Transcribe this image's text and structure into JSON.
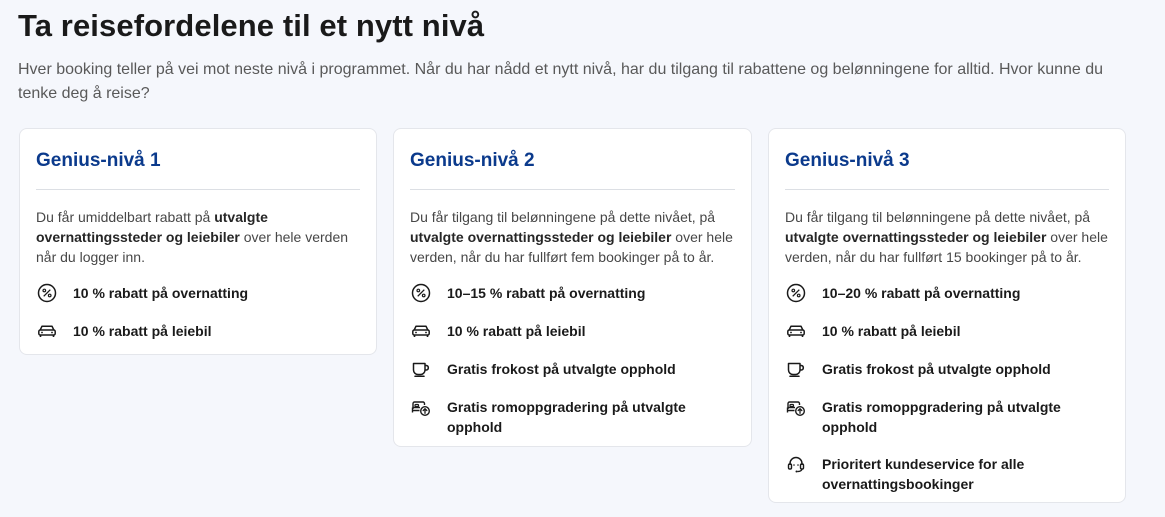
{
  "header": {
    "title": "Ta reisefordelene til et nytt nivå",
    "subtitle": "Hver booking teller på vei mot neste nivå i programmet. Når du har nådd et nytt nivå, har du tilgang til rabattene og belønningene for alltid. Hvor kunne du tenke deg å reise?"
  },
  "levels": [
    {
      "title": "Genius-nivå 1",
      "desc_pre": "Du får umiddelbart rabatt på ",
      "desc_bold": "utvalgte overnattingssteder og leiebiler",
      "desc_post": " over hele verden når du logger inn.",
      "benefits": [
        {
          "icon": "percent-icon",
          "text": "10 % rabatt på overnatting"
        },
        {
          "icon": "car-icon",
          "text": "10 % rabatt på leiebil"
        }
      ]
    },
    {
      "title": "Genius-nivå 2",
      "desc_pre": "Du får tilgang til belønningene på dette nivået, på ",
      "desc_bold": "utvalgte overnattingssteder og leiebiler",
      "desc_post": " over hele verden, når du har fullført fem bookinger på to år.",
      "benefits": [
        {
          "icon": "percent-icon",
          "text": "10–15 % rabatt på overnatting"
        },
        {
          "icon": "car-icon",
          "text": "10 % rabatt på leiebil"
        },
        {
          "icon": "coffee-cup-icon",
          "text": "Gratis frokost på utvalgte opphold"
        },
        {
          "icon": "room-upgrade-icon",
          "text": "Gratis romoppgradering på utvalgte opphold"
        }
      ]
    },
    {
      "title": "Genius-nivå 3",
      "desc_pre": "Du får tilgang til belønningene på dette nivået, på ",
      "desc_bold": "utvalgte overnattingssteder og leiebiler",
      "desc_post": " over hele verden, når du har fullført 15 bookinger på to år.",
      "benefits": [
        {
          "icon": "percent-icon",
          "text": "10–20 % rabatt på overnatting"
        },
        {
          "icon": "car-icon",
          "text": "10 % rabatt på leiebil"
        },
        {
          "icon": "coffee-cup-icon",
          "text": "Gratis frokost på utvalgte opphold"
        },
        {
          "icon": "room-upgrade-icon",
          "text": "Gratis romoppgradering på utvalgte opphold"
        },
        {
          "icon": "headset-icon",
          "text": "Prioritert kundeservice for alle overnattingsbookinger"
        }
      ]
    }
  ],
  "colors": {
    "background": "#f5f7fc",
    "card_title": "#0b3a8c",
    "text": "#1a1a1a"
  }
}
